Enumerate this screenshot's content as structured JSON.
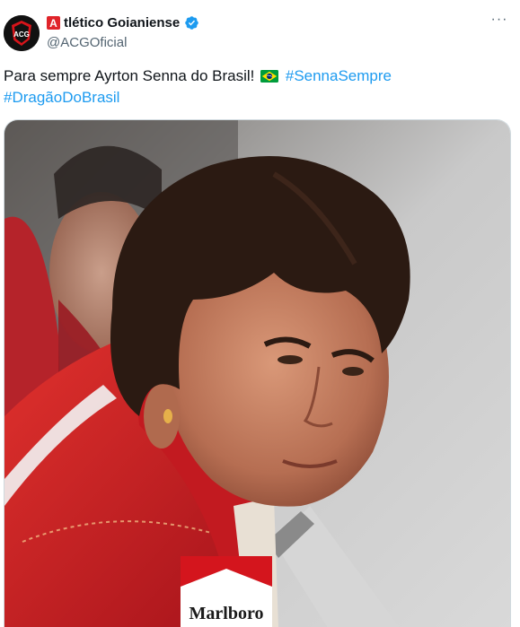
{
  "author": {
    "display_name_initial": "A",
    "display_name_rest": "tlético Goianiense",
    "handle": "@ACGOficial",
    "verified": true,
    "avatar_icon": "club-crest-icon"
  },
  "more_button": {
    "icon": "more-horizontal-icon",
    "label": "···"
  },
  "tweet": {
    "text": "Para sempre Ayrton Senna do Brasil! ",
    "flag_emoji": "brazil-flag-icon",
    "hashtag_1": "#SennaSempre",
    "hashtag_2": "#DragãoDoBrasil"
  },
  "media": {
    "description_icon": "photo",
    "patch_text": "Marlboro"
  },
  "colors": {
    "link": "#1d9bf0",
    "secondary_text": "#536471",
    "primary_text": "#0f1419",
    "verified": "#1d9bf0",
    "suit_red": "#c8171c"
  }
}
